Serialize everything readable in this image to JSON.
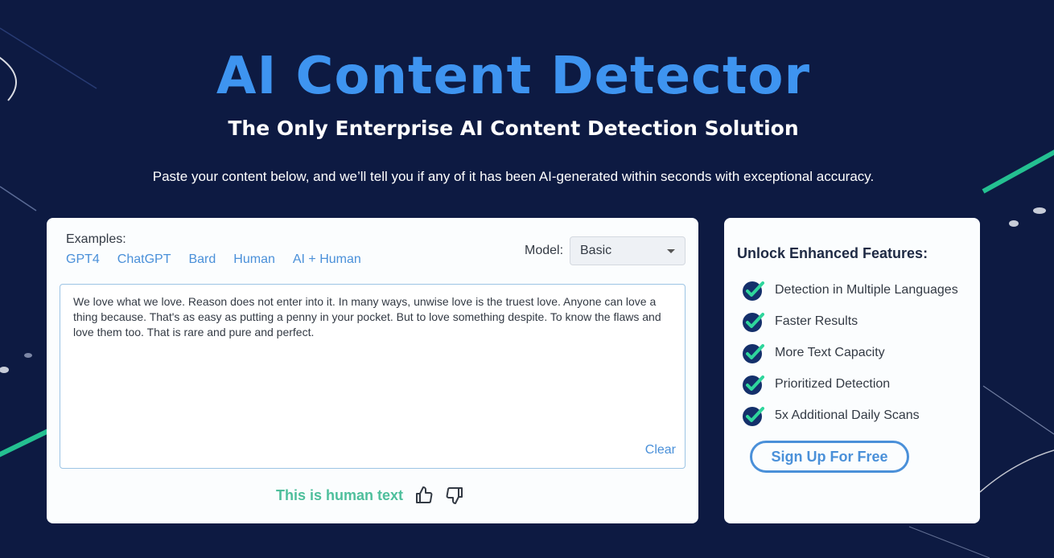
{
  "header": {
    "title": "AI Content Detector",
    "subtitle": "The Only Enterprise AI Content Detection Solution",
    "description": "Paste your content below, and we’ll tell you if any of it has been AI-generated within seconds with exceptional accuracy."
  },
  "detector": {
    "examples_label": "Examples:",
    "examples": [
      "GPT4",
      "ChatGPT",
      "Bard",
      "Human",
      "AI + Human"
    ],
    "model_label": "Model:",
    "model_value": "Basic",
    "input_text": "We love what we love. Reason does not enter into it. In many ways, unwise love is the truest love. Anyone can love a thing because. That's as easy as putting a penny in your pocket. But to love something despite. To know the flaws and love them too. That is rare and pure and perfect.",
    "clear_label": "Clear",
    "result_text": "This is human text",
    "icons": {
      "thumbs_up": "thumbs-up-icon",
      "thumbs_down": "thumbs-down-icon"
    }
  },
  "features": {
    "title": "Unlock Enhanced Features:",
    "items": [
      "Detection in Multiple Languages",
      "Faster Results",
      "More Text Capacity",
      "Prioritized Detection",
      "5x Additional Daily Scans"
    ],
    "icon": "check-circle-icon",
    "signup_label": "Sign Up For Free"
  },
  "colors": {
    "background": "#0d1a42",
    "title_blue": "#3e94f0",
    "link_blue": "#4a90d9",
    "result_green": "#4ebf9c",
    "check_green": "#2fd69c",
    "check_circle": "#14306b"
  }
}
